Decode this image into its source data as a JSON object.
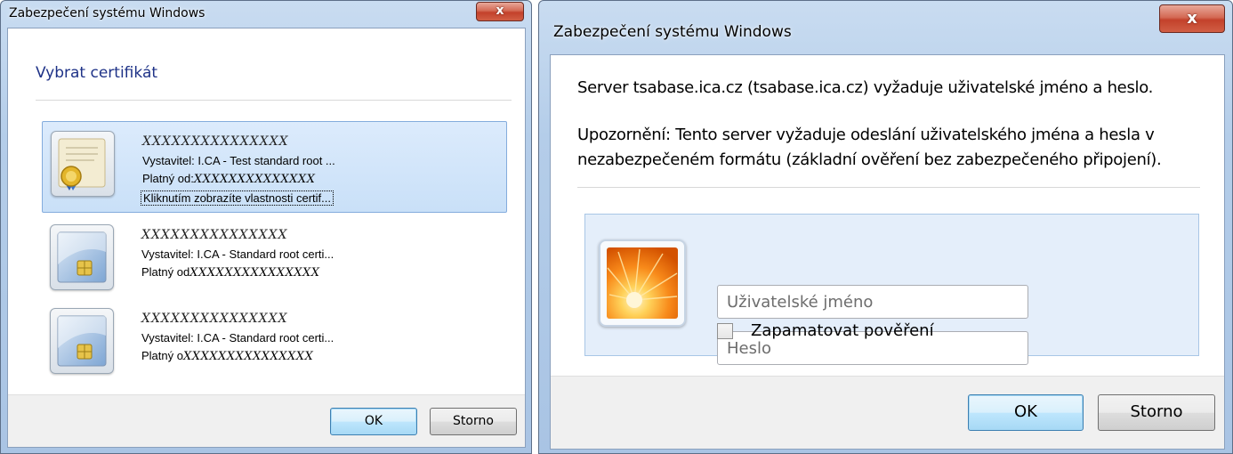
{
  "left_dialog": {
    "title": "Zabezpečení systému Windows",
    "close_label": "x",
    "heading": "Vybrat certifikát",
    "certificates": [
      {
        "name": "XXXXXXXXXXXXXXX",
        "issuer": "Vystavitel: I.CA - Test standard root ...",
        "valid_label": "Platný od:",
        "valid_value": "XXXXXXXXXXXXXX",
        "link": "Kliknutím zobrazíte vlastnosti certif...",
        "selected": true
      },
      {
        "name": "XXXXXXXXXXXXXXX",
        "issuer": "Vystavitel: I.CA - Standard root certi...",
        "valid_label": "Platný od",
        "valid_value": "XXXXXXXXXXXXXXX",
        "selected": false
      },
      {
        "name": "XXXXXXXXXXXXXXX",
        "issuer": "Vystavitel: I.CA - Standard root certi...",
        "valid_label": "Platný o",
        "valid_value": "XXXXXXXXXXXXXXX",
        "selected": false
      }
    ],
    "ok_label": "OK",
    "cancel_label": "Storno"
  },
  "right_dialog": {
    "title": "Zabezpečení systému Windows",
    "close_label": "x",
    "message_line": "Server tsabase.ica.cz (tsabase.ica.cz) vyžaduje uživatelské jméno a heslo.",
    "warning_line1": "Upozornění: Tento server vyžaduje odeslání uživatelského jména a hesla v",
    "warning_line2": "nezabezpečeném formátu (základní ověření bez zabezpečeného připojení).",
    "username_placeholder": "Uživatelské jméno",
    "password_placeholder": "Heslo",
    "remember_label": "Zapamatovat pověření",
    "remember_checked": false,
    "ok_label": "OK",
    "cancel_label": "Storno"
  },
  "colors": {
    "heading_blue": "#1e3287",
    "selection_fill": "#cfe3f9",
    "frame_blue": "#b4cde9",
    "close_red": "#c3412b",
    "credential_panel": "#e4eefa"
  }
}
